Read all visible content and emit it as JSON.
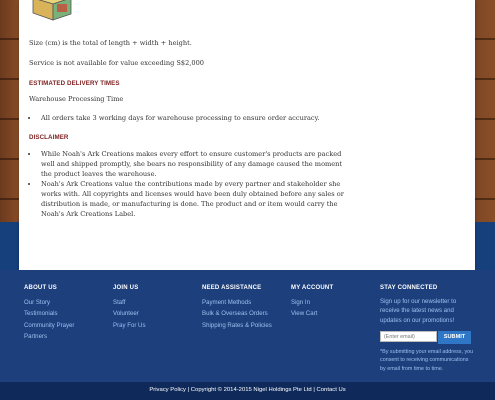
{
  "page": {
    "size_note": "Size (cm) is the total of length + width + height.",
    "service_note": "Service is not available for value exceeding S$2,000"
  },
  "delivery": {
    "heading": "ESTIMATED DELIVERY TIMES",
    "subheading": "Warehouse Processing Time",
    "items": [
      "All orders take 3 working days for warehouse processing to ensure order accuracy."
    ]
  },
  "disclaimer": {
    "heading": "DISCLAIMER",
    "items": [
      "While Noah's Ark Creations makes every effort to ensure customer's products are packed well and shipped promptly, she bears no responsibility of any damage caused the moment the product leaves the warehouse.",
      "Noah's Ark Creations value the contributions made by every partner and stakeholder she works with. All copyrights and licenses would have been duly obtained before any sales or distribution is made, or manufacturing is done. The product and or item would carry the Noah's Ark Creations Label."
    ]
  },
  "footer": {
    "about": {
      "title": "ABOUT US",
      "links": [
        "Our Story",
        "Testimonials",
        "Community Prayer",
        "Partners"
      ]
    },
    "join": {
      "title": "JOIN US",
      "links": [
        "Staff",
        "Volunteer",
        "Pray For Us"
      ]
    },
    "assist": {
      "title": "NEED ASSISTANCE",
      "links": [
        "Payment Methods",
        "Bulk & Overseas Orders",
        "Shipping Rates & Policies"
      ]
    },
    "account": {
      "title": "MY ACCOUNT",
      "links": [
        "Sign In",
        "View Cart"
      ]
    },
    "stay": {
      "title": "STAY CONNECTED",
      "text": "Sign up for our newsletter to receive the latest news and updates on our promotions!",
      "email_placeholder": "(Enter email)",
      "submit_label": "SUBMIT",
      "note": "*By submitting your email address, you consent to receiving communications by email from time to time."
    },
    "bottom": {
      "privacy": "Privacy Policy",
      "copyright": "Copyright © 2014-2015 Nigel Holdings Pte Ltd",
      "contact": "Contact Us",
      "sep": " | "
    }
  },
  "colors": {
    "heading": "#7d1e1e",
    "footer_bg": "#1d3f7c",
    "link": "#9fc0ef",
    "accent": "#2f76c6"
  }
}
